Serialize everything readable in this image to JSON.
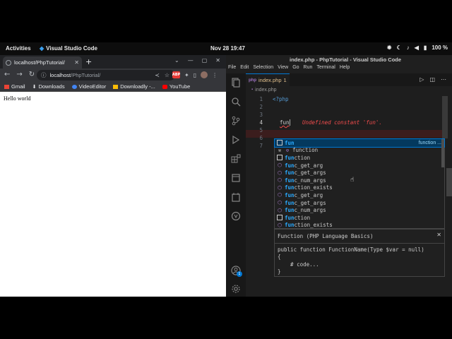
{
  "topbar": {
    "activities": "Activities",
    "app_name": "Visual Studio Code",
    "clock": "Nov 28  19:47",
    "battery": "100 %"
  },
  "chrome": {
    "tab_title": "localhost/PhpTutorial/",
    "url_host": "localhost",
    "url_path": "/PhpTutorial/",
    "bookmarks": [
      "Gmail",
      "Downloads",
      "VideoEditor",
      "Downloadly -...",
      "YouTube"
    ],
    "page_text": "Hello world"
  },
  "vscode": {
    "title": "index.php - PhpTutorial - Visual Studio Code",
    "menu": [
      "File",
      "Edit",
      "Selection",
      "View",
      "Go",
      "Run",
      "Terminal",
      "Help"
    ],
    "tab": {
      "icon": "php",
      "name": "index.php",
      "badge": "1"
    },
    "breadcrumb": "index.php",
    "line_numbers": [
      "1",
      "2",
      "3",
      "4",
      "5",
      "6",
      "7"
    ],
    "code_line1": "<?php",
    "typed": "fun",
    "error": "Undefined constant 'fun'.",
    "suggestions": [
      {
        "icon": "keyword",
        "match": "fun",
        "rest": "",
        "detail": "function ..."
      },
      {
        "icon": "wrench",
        "match": "",
        "rest": "function",
        "detail": ""
      },
      {
        "icon": "keyword",
        "match": "fun",
        "rest": "ction",
        "detail": ""
      },
      {
        "icon": "function",
        "match": "fun",
        "rest": "c_get_arg",
        "detail": ""
      },
      {
        "icon": "function",
        "match": "fun",
        "rest": "c_get_args",
        "detail": ""
      },
      {
        "icon": "function",
        "match": "fun",
        "rest": "c_num_args",
        "detail": ""
      },
      {
        "icon": "function",
        "match": "fun",
        "rest": "ction_exists",
        "detail": ""
      },
      {
        "icon": "function",
        "match": "fun",
        "rest": "c_get_arg",
        "detail": ""
      },
      {
        "icon": "function",
        "match": "fun",
        "rest": "c_get_args",
        "detail": ""
      },
      {
        "icon": "function",
        "match": "fun",
        "rest": "c_num_args",
        "detail": ""
      },
      {
        "icon": "keyword",
        "match": "fun",
        "rest": "ction",
        "detail": ""
      },
      {
        "icon": "function",
        "match": "fun",
        "rest": "ction_exists",
        "detail": ""
      }
    ],
    "details": {
      "header": "Function (PHP Language Basics)",
      "line1": "public function FunctionName(Type $var = null)",
      "line2": "{",
      "line3": "    # code...",
      "line4": "}"
    },
    "account_badge": "1"
  },
  "colors": {
    "accent": "#0078d4",
    "error": "#f14c4c",
    "match": "#2aaaff"
  }
}
